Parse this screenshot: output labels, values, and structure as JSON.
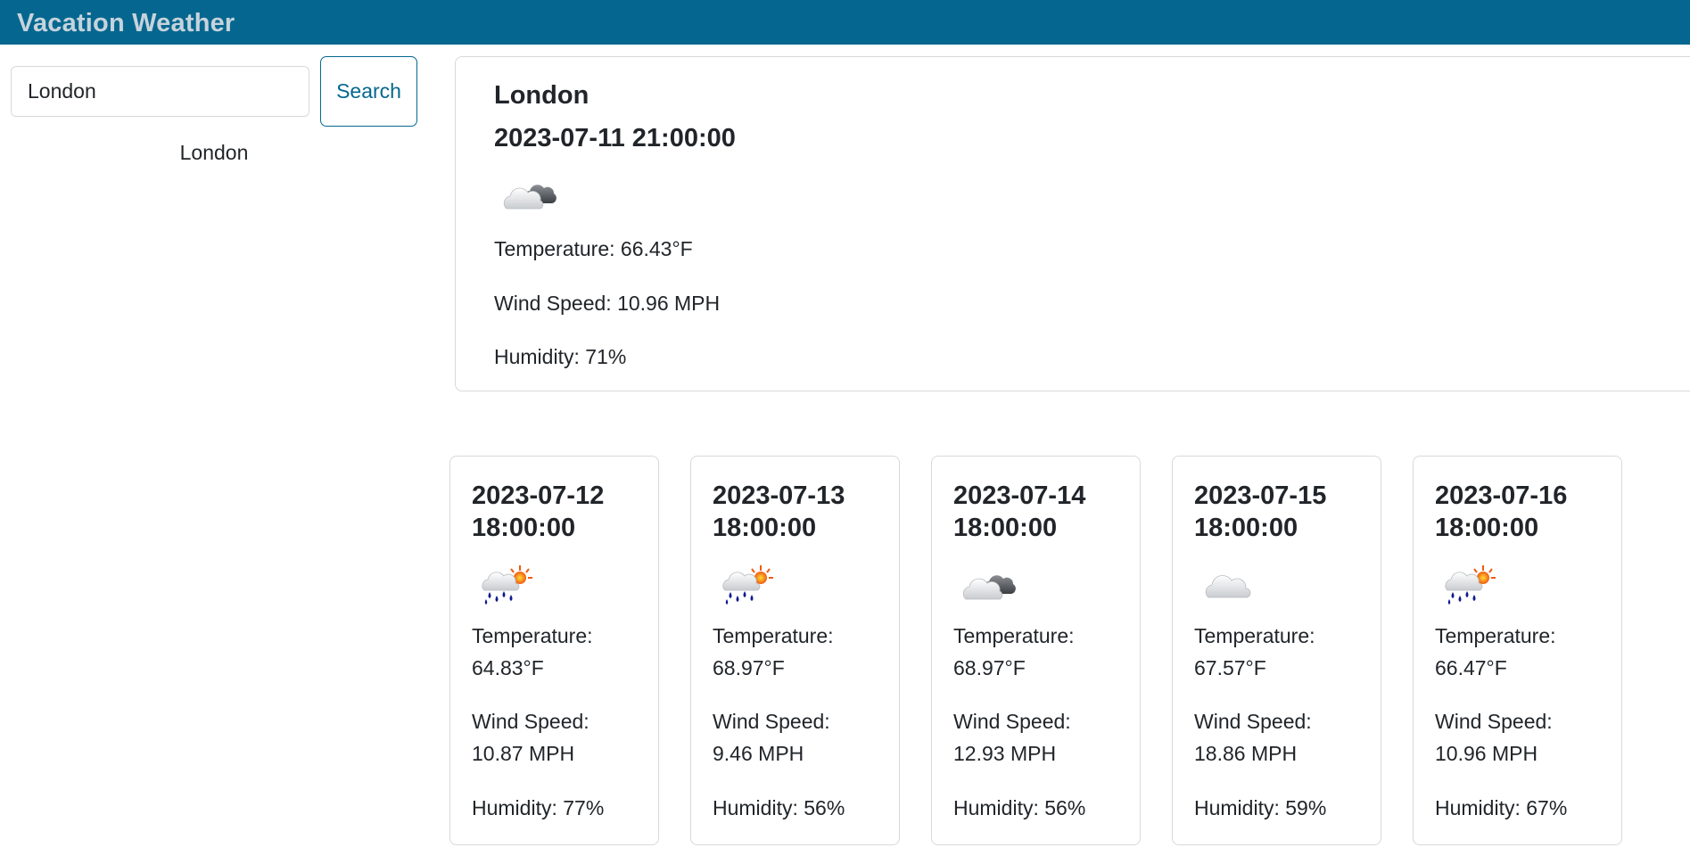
{
  "app": {
    "title": "Vacation Weather"
  },
  "search": {
    "value": "London",
    "placeholder": "",
    "button_label": "Search"
  },
  "history": [
    "London"
  ],
  "current": {
    "city": "London",
    "datetime": "2023-07-11 21:00:00",
    "icon": "broken-clouds-icon",
    "temperature": "Temperature: 66.43°F",
    "wind": "Wind Speed: 10.96 MPH",
    "humidity": "Humidity: 71%"
  },
  "forecast": [
    {
      "date": "2023-07-12",
      "time": "18:00:00",
      "icon": "light-rain-sun-icon",
      "temp_label": "Temperature:",
      "temp_value": "64.83°F",
      "wind_label": "Wind Speed:",
      "wind_value": "10.87 MPH",
      "humidity": "Humidity: 77%"
    },
    {
      "date": "2023-07-13",
      "time": "18:00:00",
      "icon": "light-rain-sun-icon",
      "temp_label": "Temperature:",
      "temp_value": "68.97°F",
      "wind_label": "Wind Speed:",
      "wind_value": "9.46 MPH",
      "humidity": "Humidity: 56%"
    },
    {
      "date": "2023-07-14",
      "time": "18:00:00",
      "icon": "broken-clouds-icon",
      "temp_label": "Temperature:",
      "temp_value": "68.97°F",
      "wind_label": "Wind Speed:",
      "wind_value": "12.93 MPH",
      "humidity": "Humidity: 56%"
    },
    {
      "date": "2023-07-15",
      "time": "18:00:00",
      "icon": "cloud-icon",
      "temp_label": "Temperature:",
      "temp_value": "67.57°F",
      "wind_label": "Wind Speed:",
      "wind_value": "18.86 MPH",
      "humidity": "Humidity: 59%"
    },
    {
      "date": "2023-07-16",
      "time": "18:00:00",
      "icon": "light-rain-sun-icon",
      "temp_label": "Temperature:",
      "temp_value": "66.47°F",
      "wind_label": "Wind Speed:",
      "wind_value": "10.96 MPH",
      "humidity": "Humidity: 67%"
    }
  ],
  "colors": {
    "navbar": "#05678f",
    "brand_text": "#c6d3dc",
    "accent": "#05678f",
    "border": "#d6d9dc"
  }
}
